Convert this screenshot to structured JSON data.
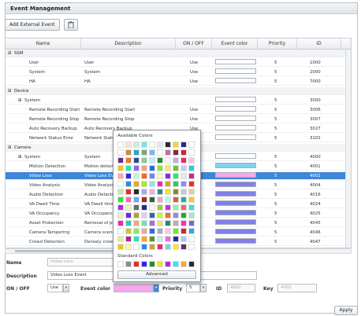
{
  "title": "Event Management",
  "toolbar": {
    "add_label": "Add External Event",
    "delete_icon": "trash-icon"
  },
  "columns": [
    "Name",
    "Description",
    "ON / OFF",
    "Event color",
    "Priority",
    "ID"
  ],
  "rows": [
    {
      "kind": "group",
      "name": "SSM"
    },
    {
      "kind": "item",
      "name": "User",
      "desc": "User",
      "on": "Use",
      "color": "#ffffff",
      "priority": "5",
      "id": "1000",
      "extra": "1"
    },
    {
      "kind": "item",
      "name": "System",
      "desc": "System",
      "on": "Use",
      "color": "#ffffff",
      "priority": "5",
      "id": "2000",
      "extra": "1"
    },
    {
      "kind": "item",
      "name": "HA",
      "desc": "HA",
      "on": "Use",
      "color": "#ffffff",
      "priority": "5",
      "id": "7000",
      "extra": "1"
    },
    {
      "kind": "group",
      "name": "Device"
    },
    {
      "kind": "sub",
      "name": "System",
      "desc": "",
      "on": "",
      "color": "#ffffff",
      "priority": "5",
      "id": "3000",
      "extra": "3"
    },
    {
      "kind": "item",
      "name": "Remote Recording Start",
      "desc": "Remote Recording Start",
      "on": "Use",
      "color": "#ffffff",
      "priority": "5",
      "id": "3006",
      "extra": "3"
    },
    {
      "kind": "item",
      "name": "Remote Recording Stop",
      "desc": "Remote Recording Stop",
      "on": "Use",
      "color": "#ffffff",
      "priority": "5",
      "id": "3007",
      "extra": "3"
    },
    {
      "kind": "item",
      "name": "Auto Recovery Backup",
      "desc": "Auto Recovery Backup",
      "on": "Use",
      "color": "#ffffff",
      "priority": "5",
      "id": "3027",
      "extra": "3"
    },
    {
      "kind": "item",
      "name": "Network Status Error",
      "desc": "Network Status Error",
      "on": "Use",
      "color": "#ffffff",
      "priority": "5",
      "id": "3102",
      "extra": "3"
    },
    {
      "kind": "group",
      "name": "Camera"
    },
    {
      "kind": "sub",
      "name": "System",
      "desc": "System",
      "on": "",
      "color": "#ffffff",
      "priority": "5",
      "id": "4000",
      "extra": "4"
    },
    {
      "kind": "item",
      "name": "Motion Detection",
      "desc": "Motion detecti",
      "on": "",
      "color": "#7fd3f2",
      "priority": "5",
      "id": "4001",
      "extra": "4"
    },
    {
      "kind": "item",
      "name": "Video Loss",
      "desc": "Video Loss Ev",
      "on": "",
      "color": "#f7a8ee",
      "priority": "5",
      "id": "4002",
      "extra": "4",
      "selected": true
    },
    {
      "kind": "item",
      "name": "Video Analysis",
      "desc": "Video Analysis",
      "on": "",
      "color": "#8080e8",
      "priority": "5",
      "id": "4004",
      "extra": "4"
    },
    {
      "kind": "item",
      "name": "Audio Detection",
      "desc": "Audio Detecti",
      "on": "",
      "color": "#8080e8",
      "priority": "5",
      "id": "4016",
      "extra": "4"
    },
    {
      "kind": "item",
      "name": "VA Dwell Time",
      "desc": "VA Dwell time",
      "on": "",
      "color": "#8080e8",
      "priority": "5",
      "id": "4024",
      "extra": "4"
    },
    {
      "kind": "item",
      "name": "VA Occupancy",
      "desc": "VA Occupancy",
      "on": "",
      "color": "#8080e8",
      "priority": "5",
      "id": "4025",
      "extra": "4"
    },
    {
      "kind": "item",
      "name": "Asset Protection",
      "desc": "Removal of pr",
      "on": "",
      "color": "#8080e8",
      "priority": "5",
      "id": "4045",
      "extra": "4"
    },
    {
      "kind": "item",
      "name": "Camera Tampering",
      "desc": "Camera scene",
      "on": "",
      "color": "#8080e8",
      "priority": "5",
      "id": "4046",
      "extra": "4"
    },
    {
      "kind": "item",
      "name": "Crowd Detection",
      "desc": "Densely crowd",
      "on": "",
      "color": "#8080e8",
      "priority": "5",
      "id": "4047",
      "extra": "4"
    }
  ],
  "form": {
    "name_label": "Name",
    "name_value": "Video Loss",
    "desc_label": "Description",
    "desc_value": "Video Loss Event",
    "onoff_label": "ON / OFF",
    "onoff_value": "Use",
    "color_label": "Event color",
    "color_value": "#f7a8ee",
    "priority_label": "Priority",
    "priority_value": "5",
    "id_label": "ID",
    "id_value": "4002",
    "key_label": "Key",
    "key_value": "4002"
  },
  "picker": {
    "available_label": "Available Colors",
    "standard_label": "Standard Colors",
    "advanced_label": "Advanced",
    "available": [
      "#ffffff",
      "#f5e6c8",
      "#c9f0d8",
      "#7ce0e8",
      "#ffffff",
      "#e8e8e8",
      "#2a2a2a",
      "#f2d23a",
      "#2a2a8a",
      "#ffffff",
      "#ffffff",
      "#c88a4a",
      "#2aa8c8",
      "#7aa87a",
      "#7ab6e8",
      "#ffffff",
      "#c86aa8",
      "#8a2a2a",
      "#c82a2a",
      "#ffffff",
      "#6a2a8a",
      "#e87a2a",
      "#2a4a8a",
      "#8ac8a8",
      "#c8e8f8",
      "#2a8a2a",
      "#ffffff",
      "#c8a8e8",
      "#e82a6a",
      "#f8c8d8",
      "#e8c82a",
      "#2ae8a8",
      "#8a6ae8",
      "#e8a87a",
      "#2a6ae8",
      "#8ae82a",
      "#f8e87a",
      "#6ac82a",
      "#c8c8f8",
      "#2ac8e8",
      "#f8a8a8",
      "#2a2ae8",
      "#c8f8c8",
      "#e86a2a",
      "#6a8ae8",
      "#f8f8c8",
      "#8a2ae8",
      "#2ae86a",
      "#e8e8e8",
      "#c82a8a",
      "#ffffff",
      "#2a8ae8",
      "#e8a82a",
      "#a8e82a",
      "#8ae8e8",
      "#e82ac8",
      "#c8a82a",
      "#2ac86a",
      "#8a8af8",
      "#f82a2a",
      "#c8e8a8",
      "#e82a2a",
      "#2a2a2a",
      "#a8a8e8",
      "#f8a8e8",
      "#2a8a8a",
      "#e8e82a",
      "#8a8a2a",
      "#c8c8c8",
      "#e8c8a8",
      "#2ae82a",
      "#f86aa8",
      "#6aa8f8",
      "#a82a2a",
      "#2a6a2a",
      "#e8a8c8",
      "#a8f8f8",
      "#c86a2a",
      "#2aa8a8",
      "#f8c82a",
      "#a82ae8",
      "#e8f8a8",
      "#6a6a6a",
      "#2a2a8a",
      "#f8f8f8",
      "#a8c82a",
      "#c82ae8",
      "#8af8a8",
      "#e86a6a",
      "#2ae8e8",
      "#f8e8c8",
      "#6a2ae8",
      "#a8a82a",
      "#e8c8f8",
      "#2a6aa8",
      "#c8f82a",
      "#f86a2a",
      "#8a8ae8",
      "#2aa82a",
      "#a8e8c8",
      "#e82aa8",
      "#2ac8c8",
      "#f8a86a",
      "#6ae8a8",
      "#a86ae8",
      "#e8e86a",
      "#2a8a6a",
      "#c8a8a8",
      "#f82ac8",
      "#6a6ae8",
      "#ffffff",
      "#c8c82a",
      "#8ae86a",
      "#e8a8a8",
      "#2a6ae8",
      "#a8a8c8",
      "#f8c8e8",
      "#6ae82a",
      "#c82a2a",
      "#2aa8e8",
      "#e8e8a8",
      "#a82a8a",
      "#2ae8a8",
      "#f8a82a",
      "#6a8a2a",
      "#c8e8e8",
      "#e86ae8",
      "#2a2aa8",
      "#a8c8f8",
      "#ffffff",
      "#e8c82a",
      "#f8f8a8",
      "#ffffff",
      "#2a8ae8",
      "#c8a82a",
      "#e82a6a",
      "#8ac8e8",
      "#f8e82a",
      "#6a2a6a",
      "#ffffff"
    ],
    "standard": [
      "#ffffff",
      "#8a8a8a",
      "#e82a2a",
      "#2a2ae8",
      "#2a8a2a",
      "#e8e82a",
      "#a82ae8",
      "#2ae8e8",
      "#f8a82a",
      "#2a2a2a"
    ]
  },
  "apply_label": "Apply"
}
